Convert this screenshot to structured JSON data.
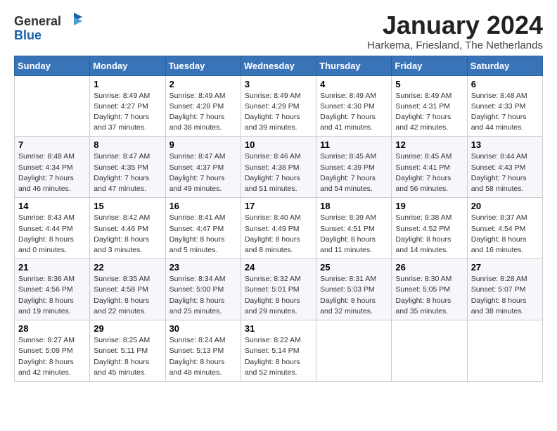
{
  "logo": {
    "general": "General",
    "blue": "Blue"
  },
  "header": {
    "month": "January 2024",
    "location": "Harkema, Friesland, The Netherlands"
  },
  "weekdays": [
    "Sunday",
    "Monday",
    "Tuesday",
    "Wednesday",
    "Thursday",
    "Friday",
    "Saturday"
  ],
  "weeks": [
    [
      {
        "day": "",
        "sunrise": "",
        "sunset": "",
        "daylight": ""
      },
      {
        "day": "1",
        "sunrise": "Sunrise: 8:49 AM",
        "sunset": "Sunset: 4:27 PM",
        "daylight": "Daylight: 7 hours and 37 minutes."
      },
      {
        "day": "2",
        "sunrise": "Sunrise: 8:49 AM",
        "sunset": "Sunset: 4:28 PM",
        "daylight": "Daylight: 7 hours and 38 minutes."
      },
      {
        "day": "3",
        "sunrise": "Sunrise: 8:49 AM",
        "sunset": "Sunset: 4:29 PM",
        "daylight": "Daylight: 7 hours and 39 minutes."
      },
      {
        "day": "4",
        "sunrise": "Sunrise: 8:49 AM",
        "sunset": "Sunset: 4:30 PM",
        "daylight": "Daylight: 7 hours and 41 minutes."
      },
      {
        "day": "5",
        "sunrise": "Sunrise: 8:49 AM",
        "sunset": "Sunset: 4:31 PM",
        "daylight": "Daylight: 7 hours and 42 minutes."
      },
      {
        "day": "6",
        "sunrise": "Sunrise: 8:48 AM",
        "sunset": "Sunset: 4:33 PM",
        "daylight": "Daylight: 7 hours and 44 minutes."
      }
    ],
    [
      {
        "day": "7",
        "sunrise": "Sunrise: 8:48 AM",
        "sunset": "Sunset: 4:34 PM",
        "daylight": "Daylight: 7 hours and 46 minutes."
      },
      {
        "day": "8",
        "sunrise": "Sunrise: 8:47 AM",
        "sunset": "Sunset: 4:35 PM",
        "daylight": "Daylight: 7 hours and 47 minutes."
      },
      {
        "day": "9",
        "sunrise": "Sunrise: 8:47 AM",
        "sunset": "Sunset: 4:37 PM",
        "daylight": "Daylight: 7 hours and 49 minutes."
      },
      {
        "day": "10",
        "sunrise": "Sunrise: 8:46 AM",
        "sunset": "Sunset: 4:38 PM",
        "daylight": "Daylight: 7 hours and 51 minutes."
      },
      {
        "day": "11",
        "sunrise": "Sunrise: 8:45 AM",
        "sunset": "Sunset: 4:39 PM",
        "daylight": "Daylight: 7 hours and 54 minutes."
      },
      {
        "day": "12",
        "sunrise": "Sunrise: 8:45 AM",
        "sunset": "Sunset: 4:41 PM",
        "daylight": "Daylight: 7 hours and 56 minutes."
      },
      {
        "day": "13",
        "sunrise": "Sunrise: 8:44 AM",
        "sunset": "Sunset: 4:43 PM",
        "daylight": "Daylight: 7 hours and 58 minutes."
      }
    ],
    [
      {
        "day": "14",
        "sunrise": "Sunrise: 8:43 AM",
        "sunset": "Sunset: 4:44 PM",
        "daylight": "Daylight: 8 hours and 0 minutes."
      },
      {
        "day": "15",
        "sunrise": "Sunrise: 8:42 AM",
        "sunset": "Sunset: 4:46 PM",
        "daylight": "Daylight: 8 hours and 3 minutes."
      },
      {
        "day": "16",
        "sunrise": "Sunrise: 8:41 AM",
        "sunset": "Sunset: 4:47 PM",
        "daylight": "Daylight: 8 hours and 5 minutes."
      },
      {
        "day": "17",
        "sunrise": "Sunrise: 8:40 AM",
        "sunset": "Sunset: 4:49 PM",
        "daylight": "Daylight: 8 hours and 8 minutes."
      },
      {
        "day": "18",
        "sunrise": "Sunrise: 8:39 AM",
        "sunset": "Sunset: 4:51 PM",
        "daylight": "Daylight: 8 hours and 11 minutes."
      },
      {
        "day": "19",
        "sunrise": "Sunrise: 8:38 AM",
        "sunset": "Sunset: 4:52 PM",
        "daylight": "Daylight: 8 hours and 14 minutes."
      },
      {
        "day": "20",
        "sunrise": "Sunrise: 8:37 AM",
        "sunset": "Sunset: 4:54 PM",
        "daylight": "Daylight: 8 hours and 16 minutes."
      }
    ],
    [
      {
        "day": "21",
        "sunrise": "Sunrise: 8:36 AM",
        "sunset": "Sunset: 4:56 PM",
        "daylight": "Daylight: 8 hours and 19 minutes."
      },
      {
        "day": "22",
        "sunrise": "Sunrise: 8:35 AM",
        "sunset": "Sunset: 4:58 PM",
        "daylight": "Daylight: 8 hours and 22 minutes."
      },
      {
        "day": "23",
        "sunrise": "Sunrise: 8:34 AM",
        "sunset": "Sunset: 5:00 PM",
        "daylight": "Daylight: 8 hours and 25 minutes."
      },
      {
        "day": "24",
        "sunrise": "Sunrise: 8:32 AM",
        "sunset": "Sunset: 5:01 PM",
        "daylight": "Daylight: 8 hours and 29 minutes."
      },
      {
        "day": "25",
        "sunrise": "Sunrise: 8:31 AM",
        "sunset": "Sunset: 5:03 PM",
        "daylight": "Daylight: 8 hours and 32 minutes."
      },
      {
        "day": "26",
        "sunrise": "Sunrise: 8:30 AM",
        "sunset": "Sunset: 5:05 PM",
        "daylight": "Daylight: 8 hours and 35 minutes."
      },
      {
        "day": "27",
        "sunrise": "Sunrise: 8:28 AM",
        "sunset": "Sunset: 5:07 PM",
        "daylight": "Daylight: 8 hours and 38 minutes."
      }
    ],
    [
      {
        "day": "28",
        "sunrise": "Sunrise: 8:27 AM",
        "sunset": "Sunset: 5:09 PM",
        "daylight": "Daylight: 8 hours and 42 minutes."
      },
      {
        "day": "29",
        "sunrise": "Sunrise: 8:25 AM",
        "sunset": "Sunset: 5:11 PM",
        "daylight": "Daylight: 8 hours and 45 minutes."
      },
      {
        "day": "30",
        "sunrise": "Sunrise: 8:24 AM",
        "sunset": "Sunset: 5:13 PM",
        "daylight": "Daylight: 8 hours and 48 minutes."
      },
      {
        "day": "31",
        "sunrise": "Sunrise: 8:22 AM",
        "sunset": "Sunset: 5:14 PM",
        "daylight": "Daylight: 8 hours and 52 minutes."
      },
      {
        "day": "",
        "sunrise": "",
        "sunset": "",
        "daylight": ""
      },
      {
        "day": "",
        "sunrise": "",
        "sunset": "",
        "daylight": ""
      },
      {
        "day": "",
        "sunrise": "",
        "sunset": "",
        "daylight": ""
      }
    ]
  ]
}
